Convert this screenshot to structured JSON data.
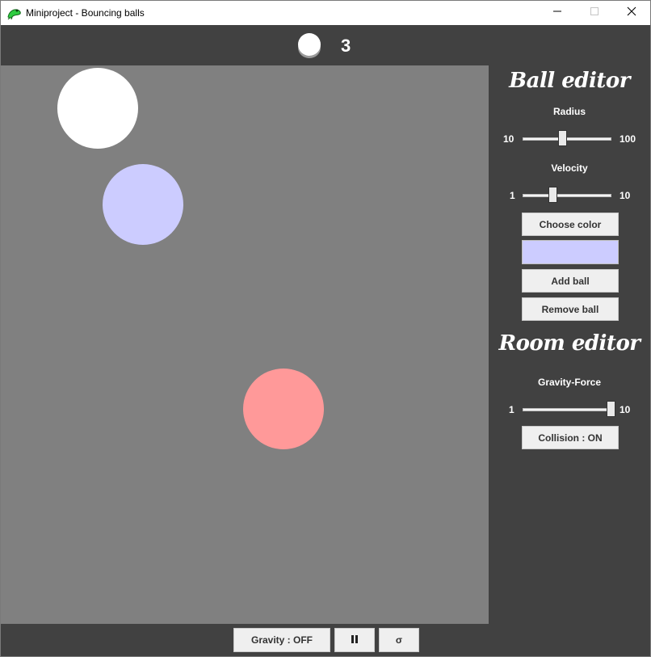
{
  "window": {
    "title": "Miniproject - Bouncing balls",
    "icon": "green-frog-icon",
    "controls": [
      "minimize-icon",
      "maximize-icon",
      "close-icon"
    ]
  },
  "header": {
    "ball_icon": "ball-icon",
    "ball_count": "3"
  },
  "canvas": {
    "background": "#808080",
    "balls": [
      {
        "color": "#ffffff"
      },
      {
        "color": "#ccccff"
      },
      {
        "color": "#ff9999"
      }
    ]
  },
  "ball_editor": {
    "title": "Ball editor",
    "radius": {
      "label": "Radius",
      "min": "10",
      "max": "100",
      "value": 45
    },
    "velocity": {
      "label": "Velocity",
      "min": "1",
      "max": "10",
      "value": 4
    },
    "choose_color_label": "Choose color",
    "selected_color": "#ccccff",
    "add_ball_label": "Add ball",
    "remove_ball_label": "Remove ball"
  },
  "room_editor": {
    "title": "Room editor",
    "gravity_force": {
      "label": "Gravity-Force",
      "min": "1",
      "max": "10",
      "value": 10
    },
    "collision_label": "Collision : ON"
  },
  "bottom_bar": {
    "gravity_label": "Gravity : OFF",
    "pause_icon": "pause-icon",
    "reset_icon": "reset-icon",
    "reset_glyph": "σ"
  }
}
